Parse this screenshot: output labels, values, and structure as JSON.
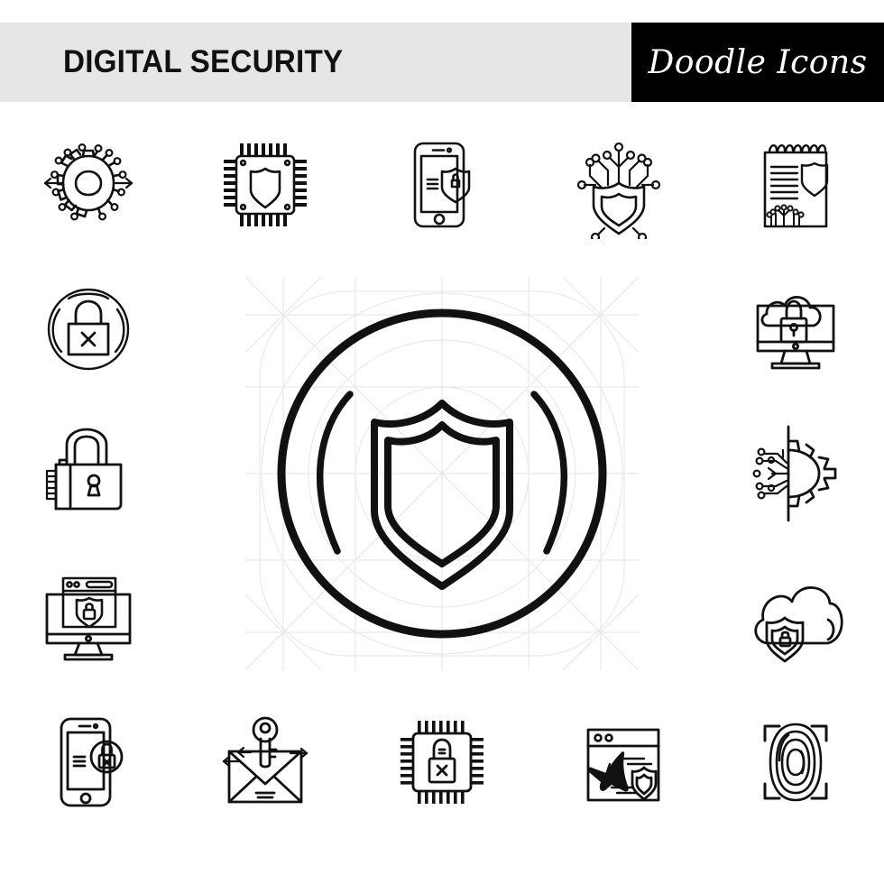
{
  "header": {
    "title": "DIGITAL SECURITY",
    "brand": "Doodle Icons",
    "band_color": "#e6e6e6",
    "brand_bg_color": "#000000",
    "brand_text_color": "#ffffff",
    "title_color": "#111111"
  },
  "page": {
    "background": "#ffffff",
    "ink_color": "#111111",
    "guide_color": "#e9e9e9",
    "columns": 5,
    "rows": 5
  },
  "featured": {
    "name": "shield-in-circle-icon",
    "label": "Shield in circle"
  },
  "icons": [
    {
      "slot": "r1c1",
      "name": "gear-circuit-icon",
      "label": "Gear with circuit nodes"
    },
    {
      "slot": "r1c2",
      "name": "cpu-shield-icon",
      "label": "Processor chip with shield"
    },
    {
      "slot": "r1c3",
      "name": "smartphone-shield-lock-icon",
      "label": "Smartphone with shield and lock"
    },
    {
      "slot": "r1c4",
      "name": "shield-circuit-icon",
      "label": "Shield with circuit branches"
    },
    {
      "slot": "r1c5",
      "name": "notepad-shield-icon",
      "label": "Spiral notepad with shield"
    },
    {
      "slot": "r2c1",
      "name": "padlock-denied-circle-icon",
      "label": "Padlock with cross in circle"
    },
    {
      "slot": "r2c5",
      "name": "monitor-cloud-lock-icon",
      "label": "Monitor with cloud and padlock"
    },
    {
      "slot": "r3c1",
      "name": "combination-padlock-icon",
      "label": "Padlock with keyhole"
    },
    {
      "slot": "r3c5",
      "name": "half-gear-circuit-icon",
      "label": "Half gear with circuit traces"
    },
    {
      "slot": "r4c1",
      "name": "monitor-browser-shield-icon",
      "label": "Monitor with browser and shield"
    },
    {
      "slot": "r4c5",
      "name": "cloud-shield-lock-icon",
      "label": "Cloud with shield and lock"
    },
    {
      "slot": "r5c1",
      "name": "smartphone-lock-badge-icon",
      "label": "Smartphone with lock badge"
    },
    {
      "slot": "r5c2",
      "name": "envelope-key-icon",
      "label": "Envelope with key"
    },
    {
      "slot": "r5c3",
      "name": "cpu-padlock-cross-icon",
      "label": "Processor chip with locked padlock"
    },
    {
      "slot": "r5c4",
      "name": "browser-megaphone-shield-icon",
      "label": "Browser window with megaphone and shield"
    },
    {
      "slot": "r5c5",
      "name": "fingerprint-scan-icon",
      "label": "Fingerprint scan frame"
    }
  ]
}
